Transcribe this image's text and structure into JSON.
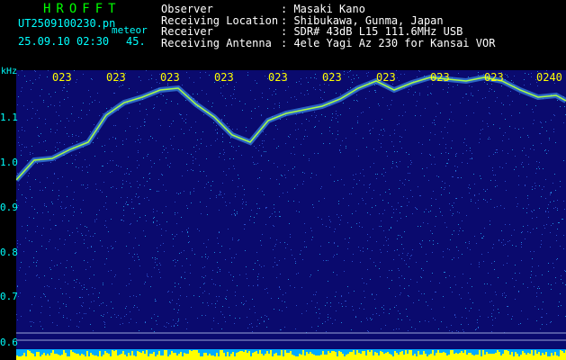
{
  "app": {
    "title": "HROFFT",
    "filename": "UT2509100230.pn",
    "mode": "meteor",
    "datetime": "25.09.10 02:30",
    "tick_value": "45."
  },
  "info": {
    "labels": [
      "Observer",
      "Receiving Location",
      "Receiver",
      "Receiving Antenna"
    ],
    "values": [
      ": Masaki Kano",
      ": Shibukawa, Gunma, Japan",
      ": SDR# 43dB L15 111.6MHz USB",
      ": 4ele Yagi Az 230 for Kansai VOR"
    ]
  },
  "axis": {
    "unit": "kHz",
    "y_ticks": [
      "1.1",
      "1.0",
      "0.9",
      "0.8",
      "0.7",
      "0.6"
    ],
    "time_ticks": [
      "023",
      "023",
      "023",
      "023",
      "023",
      "023",
      "023",
      "023",
      "023",
      "0240"
    ]
  },
  "colors": {
    "background": "#0a0a6e",
    "trace": "#aaff44",
    "baseline": "#ffff00",
    "label": "#00ffff",
    "title": "#00ff00"
  }
}
